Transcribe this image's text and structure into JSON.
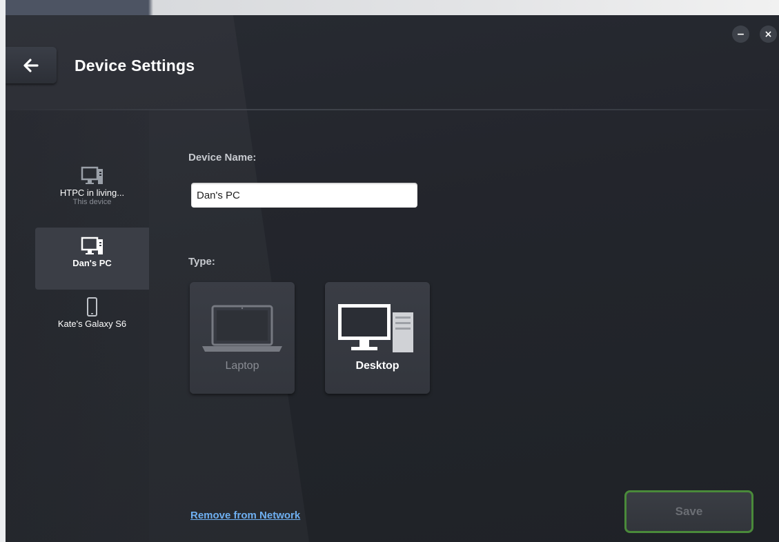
{
  "window": {
    "title": "Device Settings",
    "minimize_glyph": "−",
    "close_glyph": "×"
  },
  "sidebar": {
    "items": [
      {
        "name": "HTPC in living...",
        "subtitle": "This device",
        "icon": "desktop-icon",
        "selected": false
      },
      {
        "name": "Dan's PC",
        "subtitle": "",
        "icon": "desktop-icon",
        "selected": true
      },
      {
        "name": "Kate's Galaxy S6",
        "subtitle": "",
        "icon": "phone-icon",
        "selected": false
      }
    ]
  },
  "form": {
    "device_name_label": "Device Name:",
    "device_name_value": "Dan's PC",
    "type_label": "Type:",
    "types": [
      {
        "label": "Laptop",
        "icon": "laptop-icon",
        "selected": false
      },
      {
        "label": "Desktop",
        "icon": "desktop-computer-icon",
        "selected": true
      }
    ]
  },
  "footer": {
    "remove_link": "Remove from Network",
    "save_label": "Save"
  },
  "colors": {
    "accent_green": "#4a8a3a",
    "link_blue": "#6fb0f2",
    "background": "#25282f"
  }
}
